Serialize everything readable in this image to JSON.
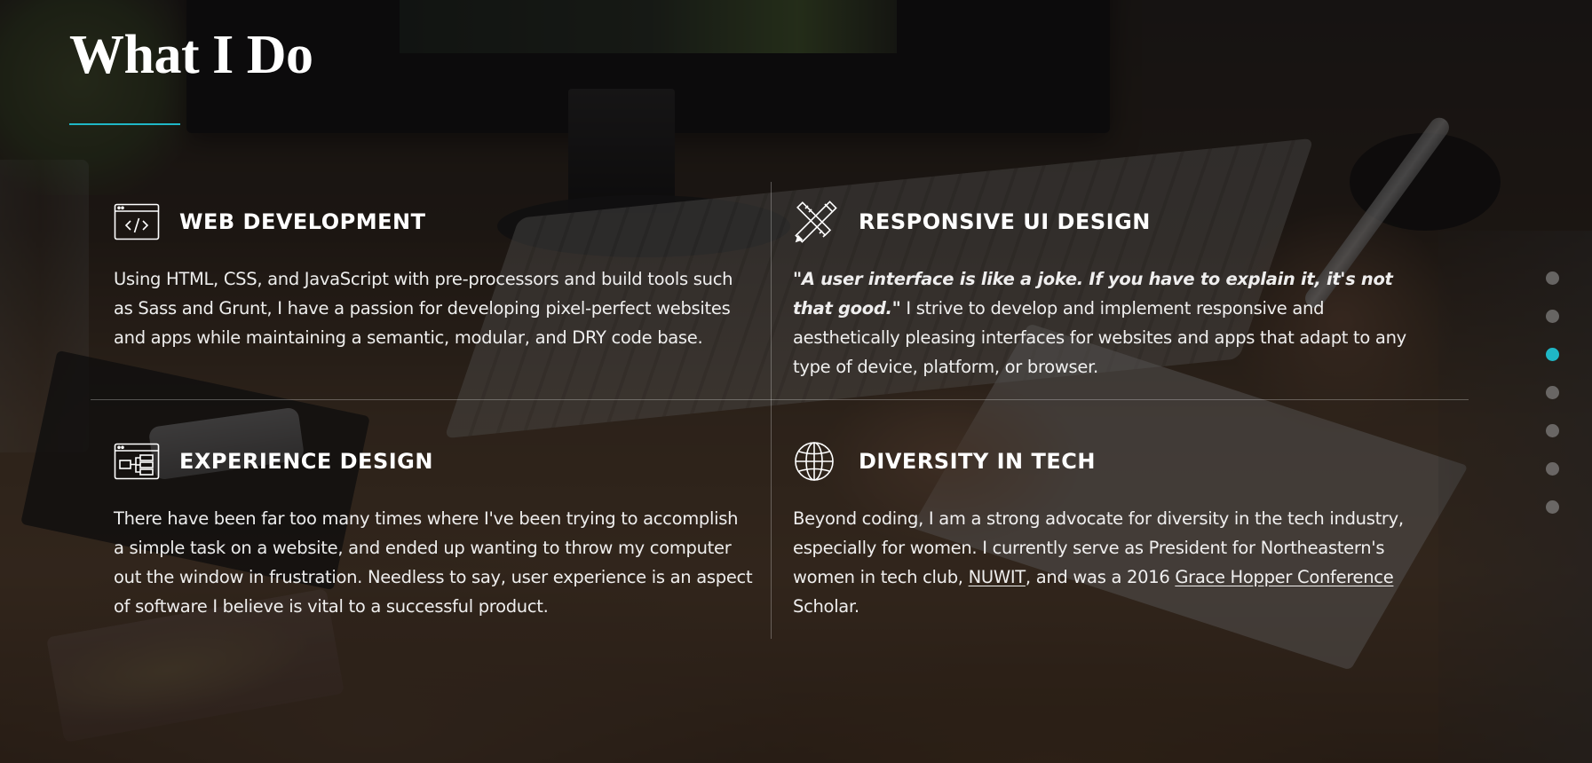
{
  "section": {
    "title": "What I Do",
    "accent_color": "#1fb7c6"
  },
  "cards": [
    {
      "icon": "code-window-icon",
      "heading": "WEB DEVELOPMENT",
      "body": "Using HTML, CSS, and JavaScript with pre-processors and build tools such as Sass and Grunt, I have a passion for developing pixel-perfect websites and apps while maintaining a semantic, modular, and DRY code base."
    },
    {
      "icon": "pencil-ruler-icon",
      "heading": "RESPONSIVE UI DESIGN",
      "quote": "\"A user interface is like a joke. If you have to explain it, it's not that good.\"",
      "body": " I strive to develop and implement responsive and aesthetically pleasing interfaces for websites and apps that adapt to any type of device, platform, or browser."
    },
    {
      "icon": "sitemap-window-icon",
      "heading": "EXPERIENCE DESIGN",
      "body": "There have been far too many times where I've been trying to accomplish a simple task on a website, and ended up wanting to throw my computer out the window in frustration. Needless to say, user experience is an aspect of software I believe is vital to a successful product."
    },
    {
      "icon": "globe-icon",
      "heading": "DIVERSITY IN TECH",
      "body_part1": "Beyond coding, I am a strong advocate for diversity in the tech industry, especially for women. I currently serve as President for Northeastern's women in tech club, ",
      "link1": "NUWIT",
      "body_part2": ", and was a 2016 ",
      "link2": "Grace Hopper Conference",
      "body_part3": " Scholar."
    }
  ],
  "nav_dots": {
    "count": 7,
    "active_index": 2
  }
}
